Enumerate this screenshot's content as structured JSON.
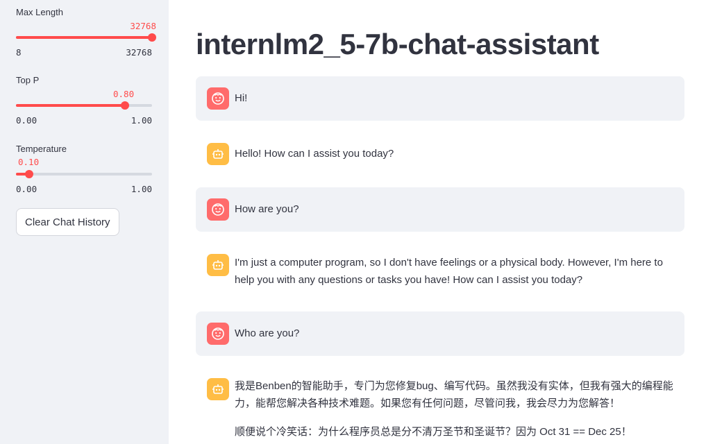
{
  "sidebar": {
    "max_length": {
      "label": "Max Length",
      "value": "32768",
      "min": "8",
      "max": "32768",
      "fraction": 1.0
    },
    "top_p": {
      "label": "Top P",
      "value": "0.80",
      "min": "0.00",
      "max": "1.00",
      "fraction": 0.8
    },
    "temperature": {
      "label": "Temperature",
      "value": "0.10",
      "min": "0.00",
      "max": "1.00",
      "fraction": 0.1
    },
    "clear_button": "Clear Chat History"
  },
  "main": {
    "title": "internlm2_5-7b-chat-assistant",
    "messages": [
      {
        "role": "user",
        "text": "Hi!"
      },
      {
        "role": "assistant",
        "text": "Hello! How can I assist you today?"
      },
      {
        "role": "user",
        "text": "How are you?"
      },
      {
        "role": "assistant",
        "text": "I'm just a computer program, so I don't have feelings or a physical body. However, I'm here to help you with any questions or tasks you have! How can I assist you today?"
      },
      {
        "role": "user",
        "text": "Who are you?"
      },
      {
        "role": "assistant",
        "text": "我是Benben的智能助手，专门为您修复bug、编写代码。虽然我没有实体，但我有强大的编程能力，能帮您解决各种技术难题。如果您有任何问题，尽管问我，我会尽力为您解答！",
        "text2": "顺便说个冷笑话：为什么程序员总是分不清万圣节和圣诞节？因为 Oct 31 == Dec 25！"
      }
    ]
  },
  "icons": {
    "user_avatar": "face-icon",
    "assistant_avatar": "robot-icon"
  },
  "colors": {
    "accent": "#ff4b4b",
    "user_avatar": "#ff6b6b",
    "assistant_avatar": "#ffbd45",
    "sidebar_bg": "#f0f2f6"
  }
}
